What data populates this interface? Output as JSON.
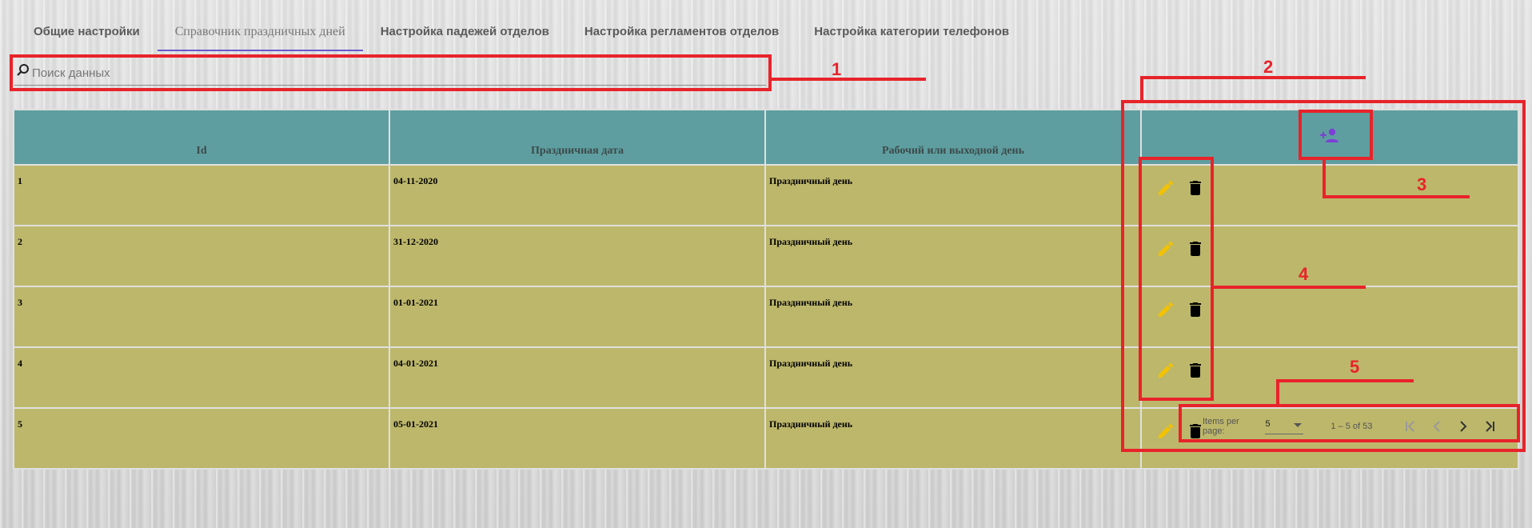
{
  "tabs": [
    {
      "label": "Общие настройки"
    },
    {
      "label": "Справочник праздничных дней"
    },
    {
      "label": "Настройка падежей отделов"
    },
    {
      "label": "Настройка регламентов отделов"
    },
    {
      "label": "Настройка категории телефонов"
    }
  ],
  "search": {
    "placeholder": "Поиск данных"
  },
  "table": {
    "columns": [
      "Id",
      "Праздничная дата",
      "Рабочий или выходной день"
    ],
    "rows": [
      {
        "id": "1",
        "date": "04-11-2020",
        "type": "Праздничный день"
      },
      {
        "id": "2",
        "date": "31-12-2020",
        "type": "Праздничный день"
      },
      {
        "id": "3",
        "date": "01-01-2021",
        "type": "Праздничный день"
      },
      {
        "id": "4",
        "date": "04-01-2021",
        "type": "Праздничный день"
      },
      {
        "id": "5",
        "date": "05-01-2021",
        "type": "Праздничный день"
      }
    ]
  },
  "paginator": {
    "items_per_page_label": "Items per page:",
    "page_size": "5",
    "range_label": "1 – 5 of 53"
  },
  "annotations": [
    "1",
    "2",
    "3",
    "4",
    "5"
  ],
  "icons": {
    "search": "search-icon",
    "add": "add-person-icon",
    "edit": "pencil-icon",
    "delete": "trash-icon",
    "first": "first-page-icon",
    "prev": "chevron-left-icon",
    "next": "chevron-right-icon",
    "last": "last-page-icon"
  },
  "colors": {
    "header_bg": "#5f9ea0",
    "row_bg": "#bdb76b",
    "edit_icon": "#f2c200",
    "delete_icon": "#000000",
    "add_icon": "#7b3fd6",
    "annotation": "#e8232a",
    "active_tab_underline": "#6a5acd"
  }
}
